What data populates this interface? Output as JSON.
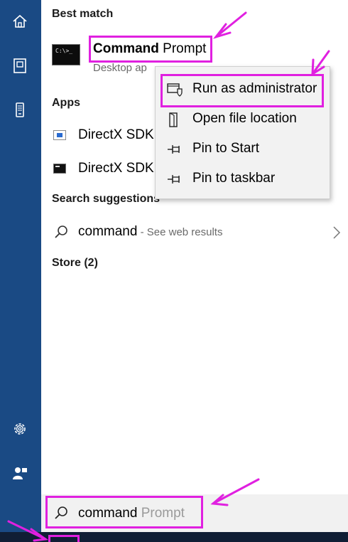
{
  "rail": {
    "items": [
      {
        "icon": "home-icon"
      },
      {
        "icon": "documents-icon"
      },
      {
        "icon": "phone-icon"
      },
      {
        "icon": "settings-icon"
      },
      {
        "icon": "user-icon"
      }
    ]
  },
  "best_match": {
    "heading": "Best match",
    "title_bold": "Command",
    "title_rest": " Prompt",
    "subtitle": "Desktop ap"
  },
  "apps": {
    "heading": "Apps",
    "items": [
      {
        "label": "DirectX SDK"
      },
      {
        "label": "DirectX SDK"
      }
    ]
  },
  "suggestions": {
    "heading": "Search suggestions",
    "item": {
      "label": "command",
      "hint": " - See web results"
    }
  },
  "store": {
    "label": "Store (2)"
  },
  "context_menu": {
    "items": [
      {
        "label": "Run as administrator",
        "icon": "shield-admin-icon"
      },
      {
        "label": "Open file location",
        "icon": "file-location-icon"
      },
      {
        "label": "Pin to Start",
        "icon": "pin-icon"
      },
      {
        "label": "Pin to taskbar",
        "icon": "pin-icon"
      }
    ]
  },
  "search": {
    "typed": "command",
    "completion": " Prompt"
  },
  "colors": {
    "rail": "#1a4a84",
    "highlight": "#e020e0",
    "menu_bg": "#f2f2f2",
    "taskbar": "#101e35"
  }
}
